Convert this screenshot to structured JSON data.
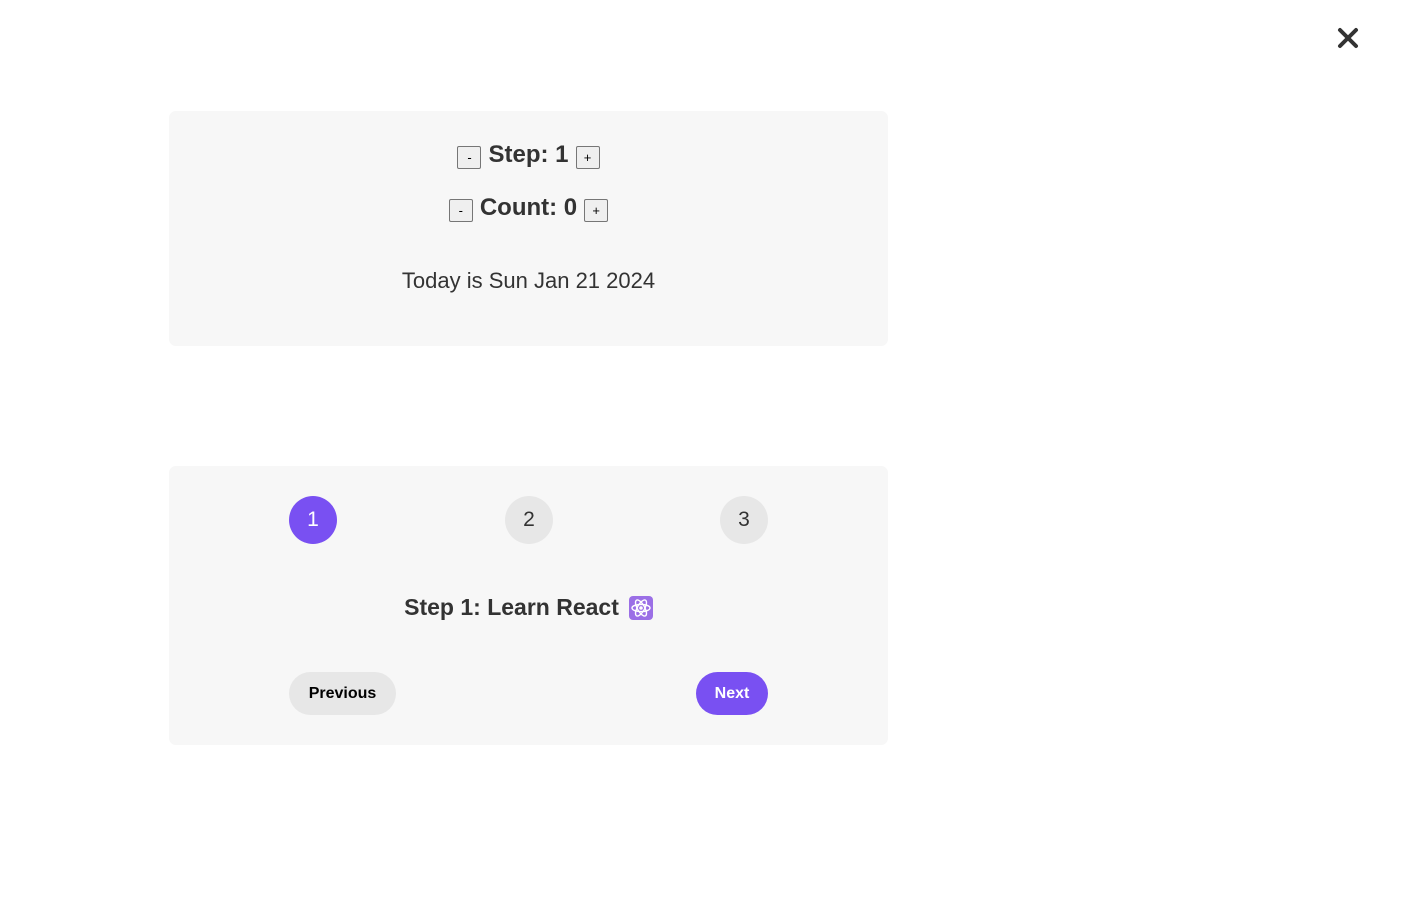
{
  "close": {
    "icon": "close-icon"
  },
  "counter": {
    "step_label": "Step: 1",
    "count_label": "Count: 0",
    "decrement_label": "-",
    "increment_label": "+",
    "date_text": "Today is Sun Jan 21 2024"
  },
  "steps": {
    "circles": [
      "1",
      "2",
      "3"
    ],
    "active_index": 0,
    "message": "Step 1: Learn React",
    "message_icon": "atom-icon",
    "previous_label": "Previous",
    "next_label": "Next"
  },
  "colors": {
    "accent": "#7950f2",
    "card_bg": "#f7f7f7",
    "inactive_circle": "#e7e7e7",
    "text": "#333333"
  }
}
